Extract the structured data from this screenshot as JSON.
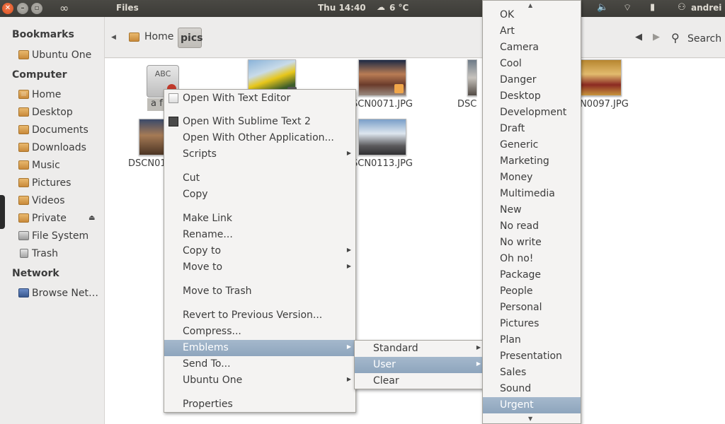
{
  "panel": {
    "app_title": "Files",
    "clock": "Thu 14:40",
    "weather_temp": "6 °C",
    "user": "andrei"
  },
  "sidebar": {
    "bookmarks_header": "Bookmarks",
    "bookmarks": [
      {
        "label": "Ubuntu One"
      }
    ],
    "computer_header": "Computer",
    "computer": [
      {
        "label": "Home"
      },
      {
        "label": "Desktop"
      },
      {
        "label": "Documents"
      },
      {
        "label": "Downloads"
      },
      {
        "label": "Music"
      },
      {
        "label": "Pictures"
      },
      {
        "label": "Videos"
      },
      {
        "label": "Private"
      },
      {
        "label": "File System"
      },
      {
        "label": "Trash"
      }
    ],
    "network_header": "Network",
    "network": [
      {
        "label": "Browse Net…"
      }
    ]
  },
  "toolbar": {
    "crumbs": [
      "Home",
      "pics"
    ],
    "search_label": "Search"
  },
  "files": {
    "text_file_label": "a f",
    "text_icon_caption": "ABC",
    "row1": [
      "SCN0071.JPG",
      "DSCN",
      "CN0097.JPG"
    ],
    "row2": [
      "DSCN01",
      "SCN0113.JPG"
    ]
  },
  "context_menu": {
    "items": [
      "Open With Text Editor",
      "Open With Sublime Text 2",
      "Open With Other Application...",
      "Scripts",
      "Cut",
      "Copy",
      "Make Link",
      "Rename...",
      "Copy to",
      "Move to",
      "Move to Trash",
      "Revert to Previous Version...",
      "Compress...",
      "Emblems",
      "Send To...",
      "Ubuntu One",
      "Properties"
    ],
    "highlighted": "Emblems"
  },
  "emblems_menu": {
    "items": [
      "Standard",
      "User",
      "Clear"
    ],
    "highlighted": "User"
  },
  "user_emblems_menu": {
    "items": [
      "OK",
      "Art",
      "Camera",
      "Cool",
      "Danger",
      "Desktop",
      "Development",
      "Draft",
      "Generic",
      "Marketing",
      "Money",
      "Multimedia",
      "New",
      "No read",
      "No write",
      "Oh no!",
      "Package",
      "People",
      "Personal",
      "Pictures",
      "Plan",
      "Presentation",
      "Sales",
      "Sound",
      "Urgent"
    ],
    "highlighted": "Urgent"
  },
  "colors": {
    "panel": "#3c3b37",
    "highlight": "#8ea5bd",
    "close": "#e0582a"
  }
}
